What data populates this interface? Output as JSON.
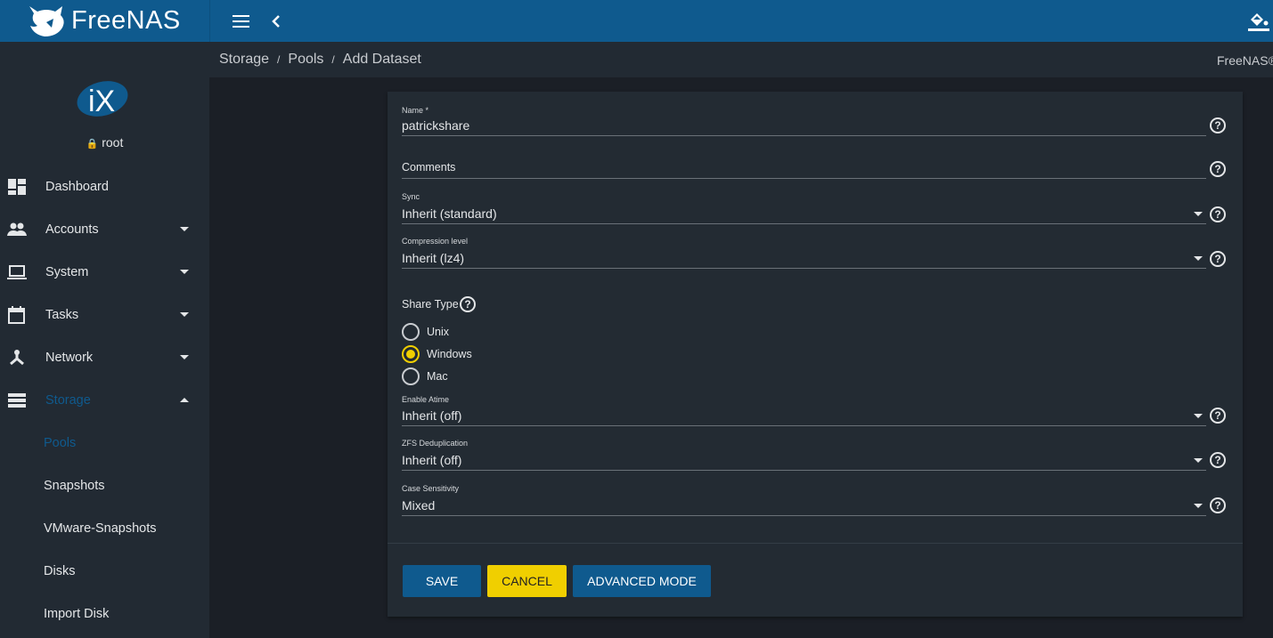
{
  "header": {
    "logo_text": "FreeNAS",
    "logo_tm": "™"
  },
  "sidebar": {
    "user": "root",
    "items": [
      {
        "label": "Dashboard"
      },
      {
        "label": "Accounts"
      },
      {
        "label": "System"
      },
      {
        "label": "Tasks"
      },
      {
        "label": "Network"
      },
      {
        "label": "Storage"
      }
    ],
    "sub_items": [
      {
        "label": "Pools"
      },
      {
        "label": "Snapshots"
      },
      {
        "label": "VMware-Snapshots"
      },
      {
        "label": "Disks"
      },
      {
        "label": "Import Disk"
      }
    ]
  },
  "breadcrumb": {
    "items": [
      "Storage",
      "Pools",
      "Add Dataset"
    ],
    "separator": "/",
    "brand": "FreeNAS®"
  },
  "form": {
    "name": {
      "label": "Name *",
      "value": "patrickshare"
    },
    "comments": {
      "placeholder": "Comments"
    },
    "sync": {
      "label": "Sync",
      "value": "Inherit (standard)"
    },
    "compression": {
      "label": "Compression level",
      "value": "Inherit (lz4)"
    },
    "share_type": {
      "label": "Share Type",
      "options": [
        "Unix",
        "Windows",
        "Mac"
      ],
      "selected": "Windows"
    },
    "atime": {
      "label": "Enable Atime",
      "value": "Inherit (off)"
    },
    "dedup": {
      "label": "ZFS Deduplication",
      "value": "Inherit (off)"
    },
    "case": {
      "label": "Case Sensitivity",
      "value": "Mixed"
    },
    "help_glyph": "?"
  },
  "buttons": {
    "save": "SAVE",
    "cancel": "CANCEL",
    "advanced": "ADVANCED MODE"
  },
  "colors": {
    "primary": "#0f5a8e",
    "accent": "#f0cf00",
    "sidebar": "#222a33",
    "card": "#232b33"
  }
}
